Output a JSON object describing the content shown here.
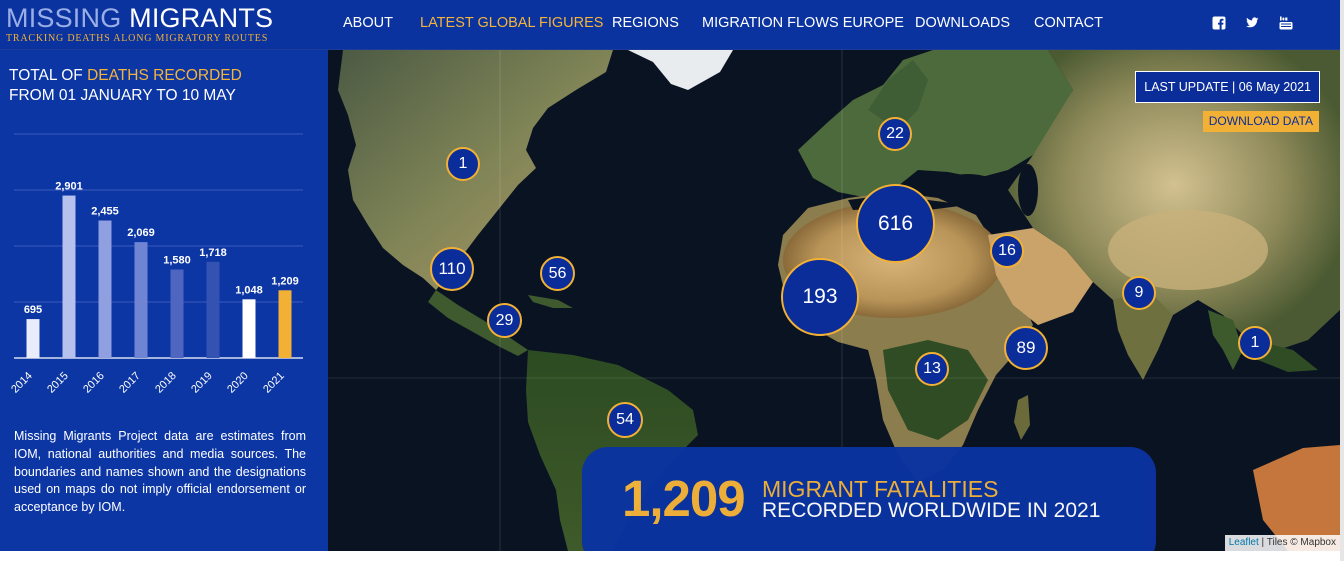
{
  "header": {
    "logo": {
      "part1": "MISSING ",
      "part2": "MIGRANTS",
      "tagline": "TRACKING DEATHS ALONG MIGRATORY ROUTES"
    },
    "nav": [
      {
        "label": "ABOUT",
        "active": false
      },
      {
        "label": "LATEST GLOBAL FIGURES",
        "active": true
      },
      {
        "label": "REGIONS",
        "active": false
      },
      {
        "label": "MIGRATION FLOWS EUROPE",
        "active": false
      },
      {
        "label": "DOWNLOADS",
        "active": false
      },
      {
        "label": "CONTACT",
        "active": false
      }
    ],
    "social": [
      "facebook-icon",
      "twitter-icon",
      "youtube-icon"
    ]
  },
  "panel": {
    "title_prefix": "TOTAL OF ",
    "title_highlight": "DEATHS RECORDED",
    "title_line2": "FROM 01 JANUARY TO 10 MAY",
    "disclaimer": "Missing Migrants Project data are estimates from IOM, national authorities and media sources. The boundaries and names shown and the designations used on maps do not imply official endorsement or acceptance by IOM."
  },
  "chart_data": {
    "type": "bar",
    "categories": [
      "2014",
      "2015",
      "2016",
      "2017",
      "2018",
      "2019",
      "2020",
      "2021"
    ],
    "values": [
      695,
      2901,
      2455,
      2069,
      1580,
      1718,
      1048,
      1209
    ],
    "value_labels": [
      "695",
      "2,901",
      "2,455",
      "2,069",
      "1,580",
      "1,718",
      "1,048",
      "1,209"
    ],
    "colors": [
      "#e8ecfb",
      "#b6c1ee",
      "#8f9fe0",
      "#6f84d3",
      "#4e66c0",
      "#3452b1",
      "#ffffff",
      "#f2b135"
    ],
    "ylim": [
      0,
      4000
    ],
    "grid": true,
    "title": "",
    "xlabel": "",
    "ylabel": ""
  },
  "map": {
    "last_update": "LAST UPDATE | 06 May 2021",
    "download_label": "DOWNLOAD DATA",
    "clusters": [
      "1",
      "22",
      "616",
      "16",
      "110",
      "56",
      "193",
      "9",
      "29",
      "89",
      "1",
      "13",
      "54"
    ],
    "totals": {
      "number": "1,209",
      "line1": "MIGRANT FATALITIES",
      "line2": "RECORDED WORLDWIDE IN 2021"
    },
    "attribution": {
      "link": "Leaflet",
      "rest": " | Tiles © Mapbox"
    }
  },
  "colors": {
    "brand_blue": "#0a33a0",
    "accent_gold": "#f2b135",
    "ocean": "#0a1321"
  }
}
